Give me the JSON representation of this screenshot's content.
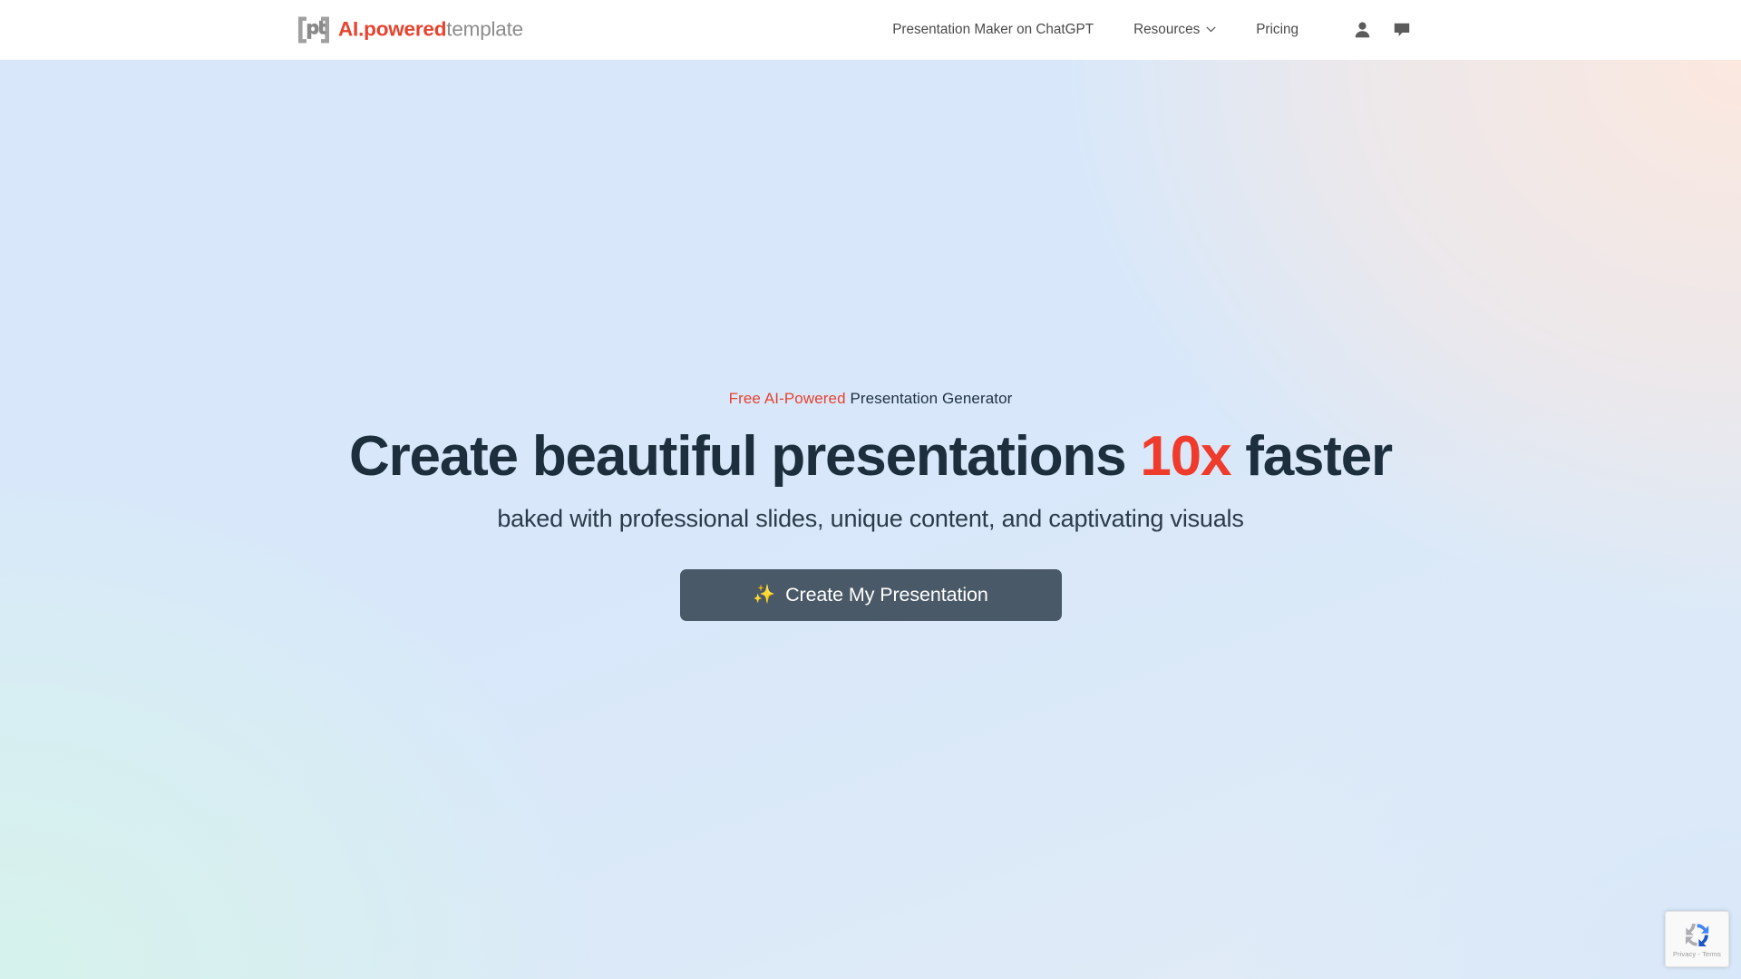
{
  "header": {
    "brand": {
      "mark_icon": "pt-logo-icon",
      "text_accent": "AI.powered",
      "text_muted": "template",
      "accent_color": "#e8422e",
      "muted_color": "#8c8c8c"
    },
    "nav": [
      {
        "label": "Presentation Maker on ChatGPT",
        "has_dropdown": false,
        "name": "nav-presentation-maker-on-chatgpt"
      },
      {
        "label": "Resources",
        "has_dropdown": true,
        "name": "nav-resources"
      },
      {
        "label": "Pricing",
        "has_dropdown": false,
        "name": "nav-pricing"
      }
    ],
    "icons": [
      {
        "icon": "user-account-icon",
        "name": "account-button"
      },
      {
        "icon": "chat-bubble-icon",
        "name": "chat-support-button"
      }
    ]
  },
  "hero": {
    "eyebrow_accent": "Free AI-Powered",
    "eyebrow_rest": " Presentation Generator",
    "headline_part1": "Create beautiful presentations ",
    "headline_accent": "10x",
    "headline_part2": " faster",
    "subheadline": "baked with professional slides, unique content, and captivating visuals",
    "cta_icon": "✨",
    "cta_label": "Create My Presentation",
    "colors": {
      "headline": "#1d2f3d",
      "accent_red": "#ef3b2c",
      "cta_background": "#4a5967",
      "cta_text": "#ffffff",
      "bg_top_left": "#d8e8fa",
      "bg_top_right": "#fde8de",
      "bg_bottom_left": "#d6f3eb",
      "bg_bottom_right": "#d6e7fa"
    }
  },
  "recaptcha": {
    "icon": "recaptcha-logo-icon",
    "privacy_label": "Privacy",
    "separator": "-",
    "terms_label": "Terms",
    "full_text": "Privacy - Terms"
  }
}
